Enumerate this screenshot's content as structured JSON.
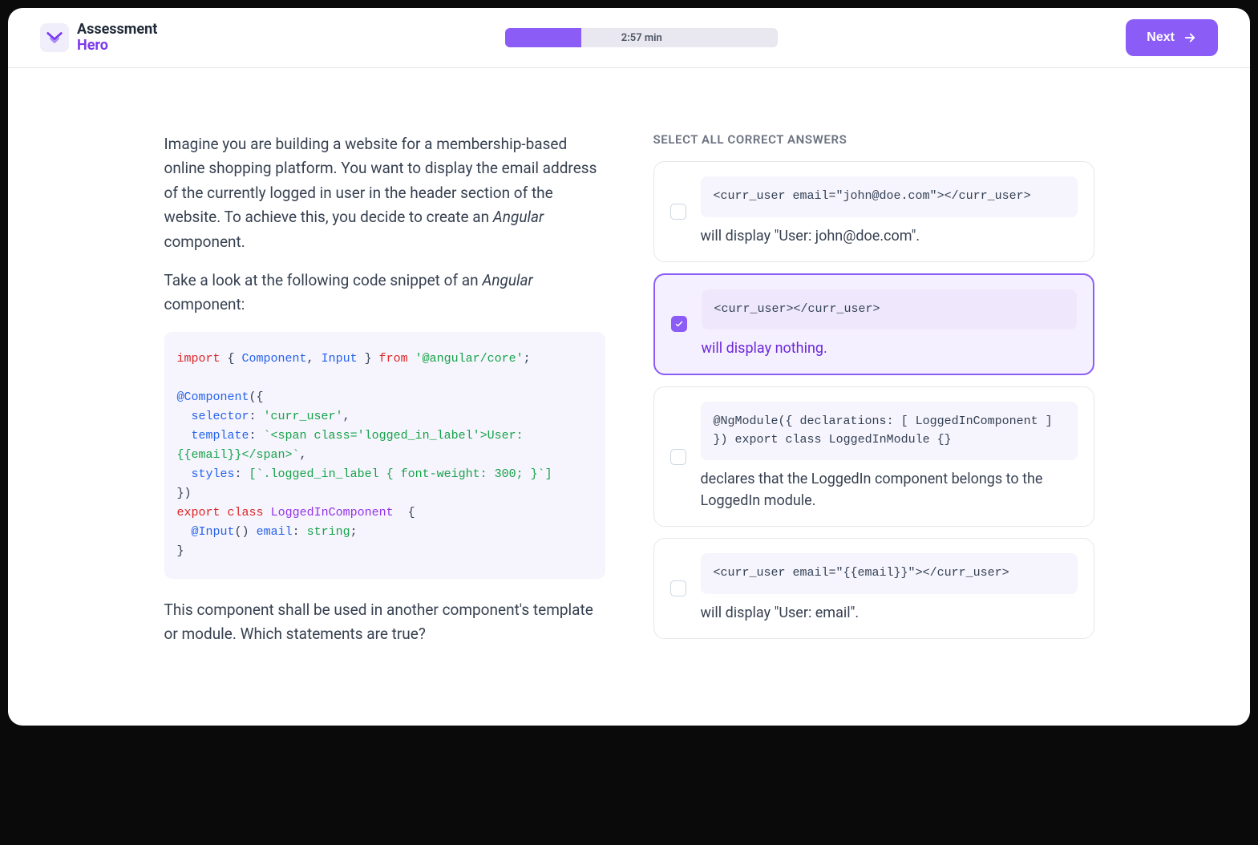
{
  "header": {
    "brand_line1": "Assessment",
    "brand_line2": "Hero",
    "timer": "2:57 min",
    "next_label": "Next"
  },
  "question": {
    "para1_a": "Imagine you are building a website for a membership-based online shopping platform. You want to display the email address of the currently logged in user in the header section of the website. To achieve this, you decide to create an ",
    "para1_em": "Angular",
    "para1_b": " component.",
    "para2_a": "Take a look at the following code snippet of an ",
    "para2_em": "Angular",
    "para2_b": " component:",
    "para3": "This component shall be used in another component's template or module. Which statements are true?",
    "code": {
      "kw_import": "import",
      "brace_open_sp": " { ",
      "cls_component": "Component",
      "comma_sp": ", ",
      "cls_input": "Input",
      "sp_brace_close_sp": " } ",
      "kw_from": "from",
      "sp": " ",
      "str_core": "'@angular/core'",
      "semi": ";",
      "blank": "",
      "ann_component": "@Component",
      "paren_brace_open": "({",
      "indent": "  ",
      "attr_selector": "selector",
      "colon_sp": ": ",
      "str_curr_user": "'curr_user'",
      "comma": ",",
      "attr_template": "template",
      "str_template": "`<span class='logged_in_label'>User: {{email}}</span>`",
      "attr_styles": "styles",
      "str_styles": "[`.logged_in_label { font-weight: 300; }`]",
      "brace_paren_close": "})",
      "kw_export": "export",
      "kw_class": "class",
      "name_loggedin": "LoggedInComponent",
      "sp_brace_open": "  {",
      "ann_input": "@Input",
      "parens": "()",
      "attr_email": "email",
      "type_string": "string",
      "brace_close": "}"
    }
  },
  "answers": {
    "label": "SELECT ALL CORRECT ANSWERS",
    "a1": {
      "code_pre": "<curr_user email=",
      "code_str": "\"john@doe.com\"",
      "code_post": "></curr_user>",
      "text": "will display \"User: john@doe.com\"."
    },
    "a2": {
      "code": "<curr_user></curr_user>",
      "text": "will display nothing."
    },
    "a3": {
      "ann_ngmodule": "@NgModule",
      "pbo": "({ ",
      "attr_decl": "declarations",
      "colon_sp": ": ",
      "brkt_open": "[ ",
      "name_licomp": "LoggedInComponent",
      "brkt_close_pbc": " ] }) ",
      "kw_export": "export",
      "sp": " ",
      "kw_class": "class",
      "name_mod_sp": " LoggedInModule ",
      "braces": "{}",
      "text": "declares that the LoggedIn component belongs to the LoggedIn module."
    },
    "a4": {
      "code_pre": "<curr_user email=",
      "code_str": "\"{{email}}\"",
      "code_post": "></curr_user>",
      "text": "will display \"User: email\"."
    }
  }
}
